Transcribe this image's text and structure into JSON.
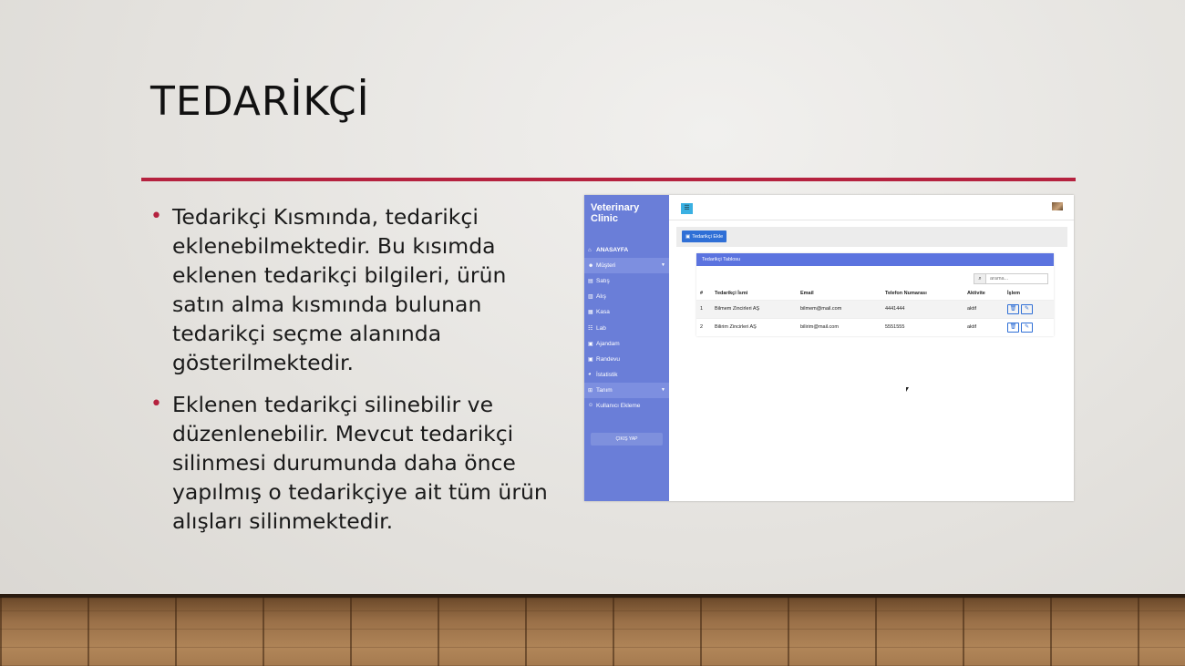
{
  "slide": {
    "title": "TEDARİKÇİ",
    "bullets": [
      "Tedarikçi Kısmında, tedarikçi eklenebilmektedir. Bu kısımda eklenen tedarikçi bilgileri, ürün satın alma kısmında bulunan tedarikçi seçme alanında gösterilmektedir.",
      "Eklenen tedarikçi silinebilir ve düzenlenebilir. Mevcut tedarikçi silinmesi durumunda daha önce yapılmış o tedarikçiye ait tüm ürün alışları silinmektedir."
    ]
  },
  "app": {
    "brand": "Veterinary Clinic",
    "nav": [
      {
        "label": "ANASAYFA",
        "icon": "home-icon"
      },
      {
        "label": "Müşteri",
        "icon": "users-icon"
      },
      {
        "label": "Satış",
        "icon": "cart-icon"
      },
      {
        "label": "Alış",
        "icon": "truck-icon"
      },
      {
        "label": "Kasa",
        "icon": "cash-icon"
      },
      {
        "label": "Lab",
        "icon": "lab-icon"
      },
      {
        "label": "Ajandam",
        "icon": "calendar-icon"
      },
      {
        "label": "Randevu",
        "icon": "calendar-check-icon"
      },
      {
        "label": "İstatistik",
        "icon": "chart-pie-icon"
      },
      {
        "label": "Tanım",
        "icon": "plus-square-icon"
      },
      {
        "label": "Kullanıcı Ekleme",
        "icon": "user-plus-icon"
      }
    ],
    "logout": "ÇIKIŞ YAP",
    "add_button": "Tedarikçi Ekle",
    "card_title": "Tedarikçi Tablosu",
    "search_placeholder": "arama...",
    "table": {
      "headers": [
        "#",
        "Tedarikçi İsmi",
        "Email",
        "Telefon Numarası",
        "Aktivite",
        "İşlem"
      ],
      "rows": [
        [
          "1",
          "Bilmem Zincirleri AŞ",
          "bilmem@mail.com",
          "4441444",
          "aktif"
        ],
        [
          "2",
          "Bilirim Zincirleri AŞ",
          "bilirim@mail.com",
          "5551555",
          "aktif"
        ]
      ]
    },
    "colors": {
      "sidebar": "#6a7ed8",
      "primary": "#2f6fd6",
      "accent": "#b5223f"
    }
  }
}
